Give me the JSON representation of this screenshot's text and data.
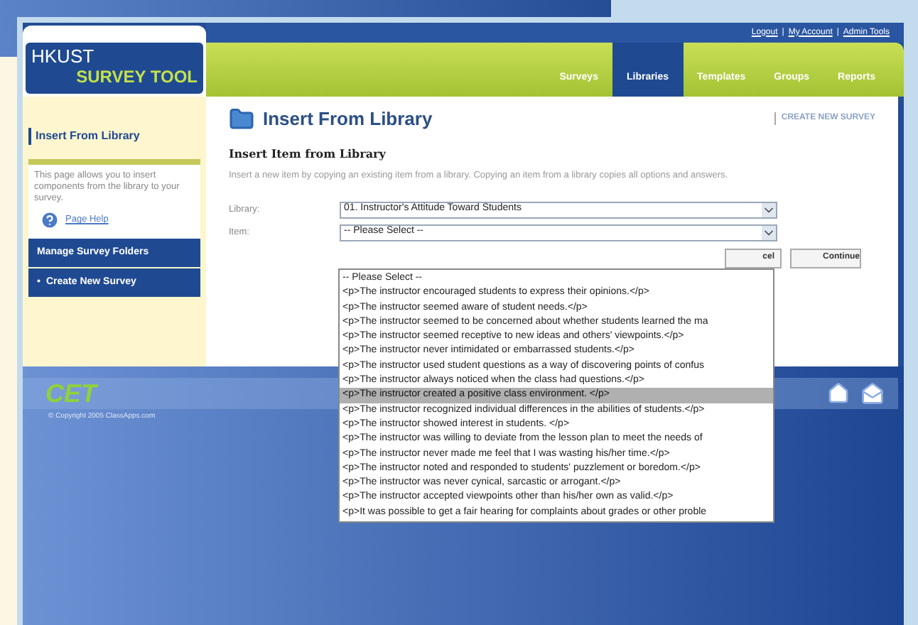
{
  "brand": {
    "line_1": "HKUST",
    "line_2": "SURVEY TOOL"
  },
  "top_links": [
    "Logout",
    "My Account",
    "Admin Tools"
  ],
  "top_link_separator": "|",
  "nav_tabs": [
    {
      "label": "Surveys",
      "selected": false
    },
    {
      "label": "Libraries",
      "selected": true
    },
    {
      "label": "Templates",
      "selected": false
    },
    {
      "label": "Groups",
      "selected": false
    },
    {
      "label": "Reports",
      "selected": false
    }
  ],
  "sidebar": {
    "title": "Insert From Library",
    "description": "This page allows you to insert components from the library to your survey.",
    "help_link": "Page Help",
    "buttons": [
      {
        "label": "Manage Survey Folders",
        "kind": "plain"
      },
      {
        "label": "Create New Survey",
        "kind": "bullet",
        "bullet": "•"
      }
    ]
  },
  "page": {
    "title": "Insert From Library",
    "create_link": "CREATE NEW SURVEY",
    "section_title": "Insert Item from Library",
    "description": "Insert a new item by copying an existing item from a library. Copying an item from a library copies all options and answers.",
    "fields": [
      {
        "label": "Library:",
        "value": "01. Instructor's Attitude Toward Students"
      },
      {
        "label": "Item:",
        "value": "-- Please Select --"
      }
    ],
    "buttons": [
      "cel",
      "Continue"
    ]
  },
  "item_dropdown": {
    "options": [
      {
        "text": "-- Please Select --",
        "selected": false
      },
      {
        "text": "<p>The instructor encouraged students to express their opinions.</p>",
        "selected": false
      },
      {
        "text": "<p>The instructor seemed aware of student needs.</p>",
        "selected": false
      },
      {
        "text": "<p>The instructor seemed to be concerned about whether students learned the ma",
        "selected": false
      },
      {
        "text": "<p>The instructor seemed receptive to new ideas and others' viewpoints.</p>",
        "selected": false
      },
      {
        "text": "<p>The instructor never intimidated or embarrassed students.</p>",
        "selected": false
      },
      {
        "text": "<p>The instructor used student questions as a way of discovering points of confus",
        "selected": false
      },
      {
        "text": "<p>The instructor always noticed when the class had questions.</p>",
        "selected": false
      },
      {
        "text": "<p>The instructor created a positive class environment. </p>",
        "selected": true
      },
      {
        "text": "<p>The instructor recognized individual differences in the abilities of students.</p>",
        "selected": false
      },
      {
        "text": "<p>The instructor showed interest in students. </p>",
        "selected": false
      },
      {
        "text": "<p>The instructor was willing to deviate from the lesson plan to meet the needs of",
        "selected": false
      },
      {
        "text": "<p>The instructor never made me feel that I was wasting his/her time.</p>",
        "selected": false
      },
      {
        "text": "<p>The instructor noted and responded to students' puzzlement or boredom.</p>",
        "selected": false
      },
      {
        "text": "<p>The instructor was never cynical, sarcastic or arrogant.</p>",
        "selected": false
      },
      {
        "text": "<p>The instructor accepted viewpoints other than his/her own as valid.</p>",
        "selected": false
      },
      {
        "text": "<p>It was possible to get a fair hearing for complaints about grades or other proble",
        "selected": false
      }
    ]
  },
  "footer": {
    "logo": "CET",
    "copyright": "© Copyright 2005 ClassApps.com"
  }
}
